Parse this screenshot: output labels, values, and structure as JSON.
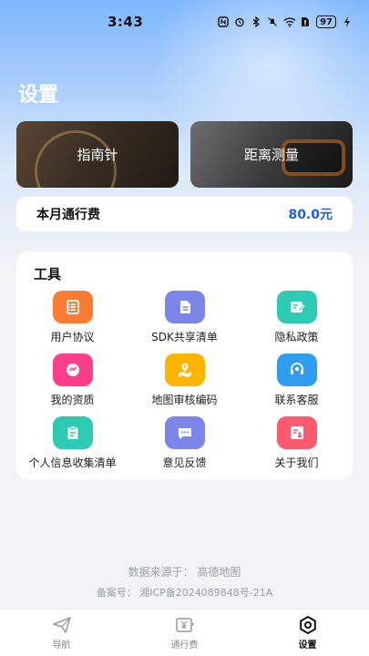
{
  "status_bar": {
    "time": "3:43",
    "battery": "97",
    "icons": [
      "nfc-icon",
      "alarm-icon",
      "bluetooth-icon",
      "mute-icon",
      "wifi-icon",
      "sim-icon",
      "battery-icon",
      "charging-icon"
    ]
  },
  "header": {
    "title": "设置"
  },
  "cards": {
    "compass_label": "指南针",
    "measure_label": "距离测量"
  },
  "toll": {
    "label": "本月通行费",
    "value": "80.0元"
  },
  "tools": {
    "title": "工具",
    "items": [
      {
        "label": "用户协议",
        "icon": "document-list-icon",
        "color": "#ff7a33"
      },
      {
        "label": "SDK共享清单",
        "icon": "file-icon",
        "color": "#7b86e8"
      },
      {
        "label": "隐私政策",
        "icon": "edit-icon",
        "color": "#2ecbb4"
      },
      {
        "label": "我的资质",
        "icon": "badge-icon",
        "color": "#ff3d8a"
      },
      {
        "label": "地图审核编码",
        "icon": "map-pin-icon",
        "color": "#ffb400"
      },
      {
        "label": "联系客服",
        "icon": "headset-icon",
        "color": "#2f9ef0"
      },
      {
        "label": "个人信息收集清单",
        "icon": "clipboard-icon",
        "color": "#2ecbb4"
      },
      {
        "label": "意见反馈",
        "icon": "chat-icon",
        "color": "#7b86e8"
      },
      {
        "label": "关于我们",
        "icon": "profile-card-icon",
        "color": "#ff5a6e"
      }
    ]
  },
  "footer": {
    "source": "数据来源于： 高德地图",
    "record": "备案号： 湘ICP备2024089848号-21A"
  },
  "nav": {
    "items": [
      {
        "label": "导航",
        "icon": "paper-plane-icon"
      },
      {
        "label": "通行费",
        "icon": "toll-icon"
      },
      {
        "label": "设置",
        "icon": "settings-icon"
      }
    ],
    "active": "设置"
  }
}
